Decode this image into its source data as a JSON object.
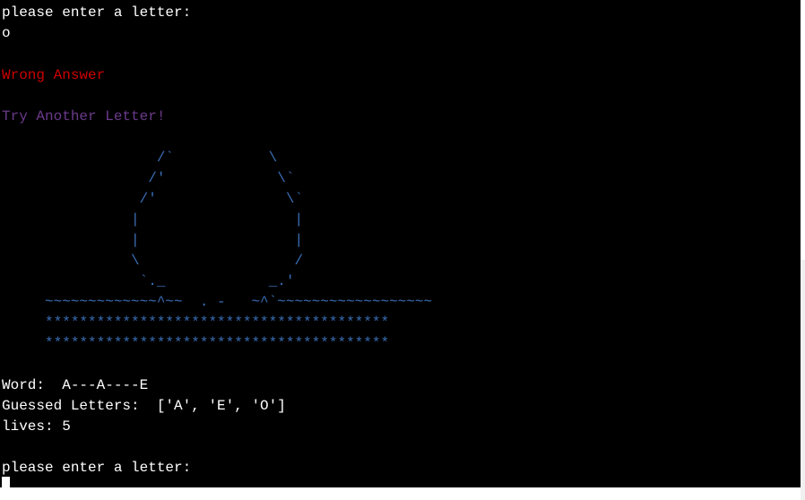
{
  "terminal": {
    "prompt_1": "please enter a letter:",
    "input_1": "o",
    "wrong_message": "Wrong Answer",
    "try_again_message": "Try Another Letter!",
    "ascii_art": "                  /`           \\\n                 /'             \\`\n                /'               \\`\n               |                  |\n               |                  |\n               \\                  /\n                `._            _.'\n     ~~~~~~~~~~~~~^~~  . -   ~^`~~~~~~~~~~~~~~~~~~\n     ****************************************\n     ****************************************",
    "word_line": "Word:  A---A----E",
    "guessed_line": "Guessed Letters:  ['A', 'E', 'O']",
    "lives_line": "lives: 5",
    "prompt_2": "please enter a letter:"
  },
  "colors": {
    "background": "#000000",
    "text": "#ffffff",
    "error": "#cc0000",
    "hint": "#6b3a8c",
    "art": "#3a6fb7"
  }
}
